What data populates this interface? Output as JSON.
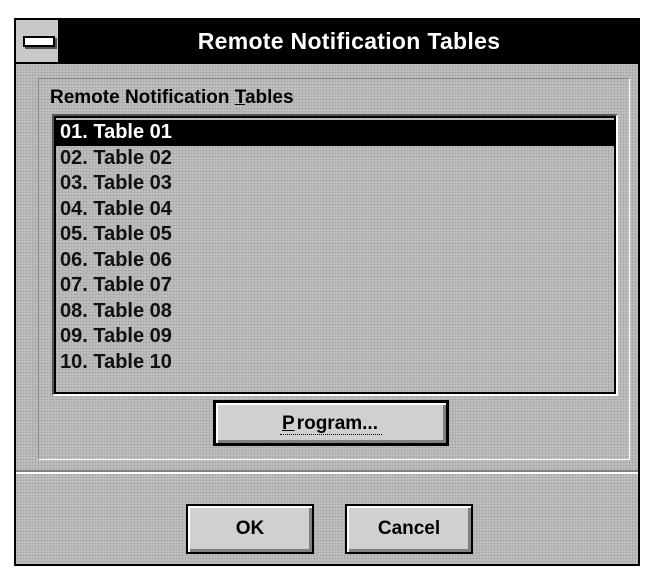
{
  "window": {
    "title": "Remote Notification Tables"
  },
  "group": {
    "label_prefix": "Remote Notification ",
    "label_mnemonic": "T",
    "label_suffix": "ables"
  },
  "list": {
    "items": [
      "01. Table 01",
      "02. Table 02",
      "03. Table 03",
      "04. Table 04",
      "05. Table 05",
      "06. Table 06",
      "07. Table 07",
      "08. Table 08",
      "09. Table 09",
      "10. Table 10"
    ],
    "selected_index": 0
  },
  "buttons": {
    "program_mnemonic": "P",
    "program_rest": "rogram...",
    "ok": "OK",
    "cancel": "Cancel"
  },
  "icons": {
    "system_menu": "system-menu-icon"
  }
}
